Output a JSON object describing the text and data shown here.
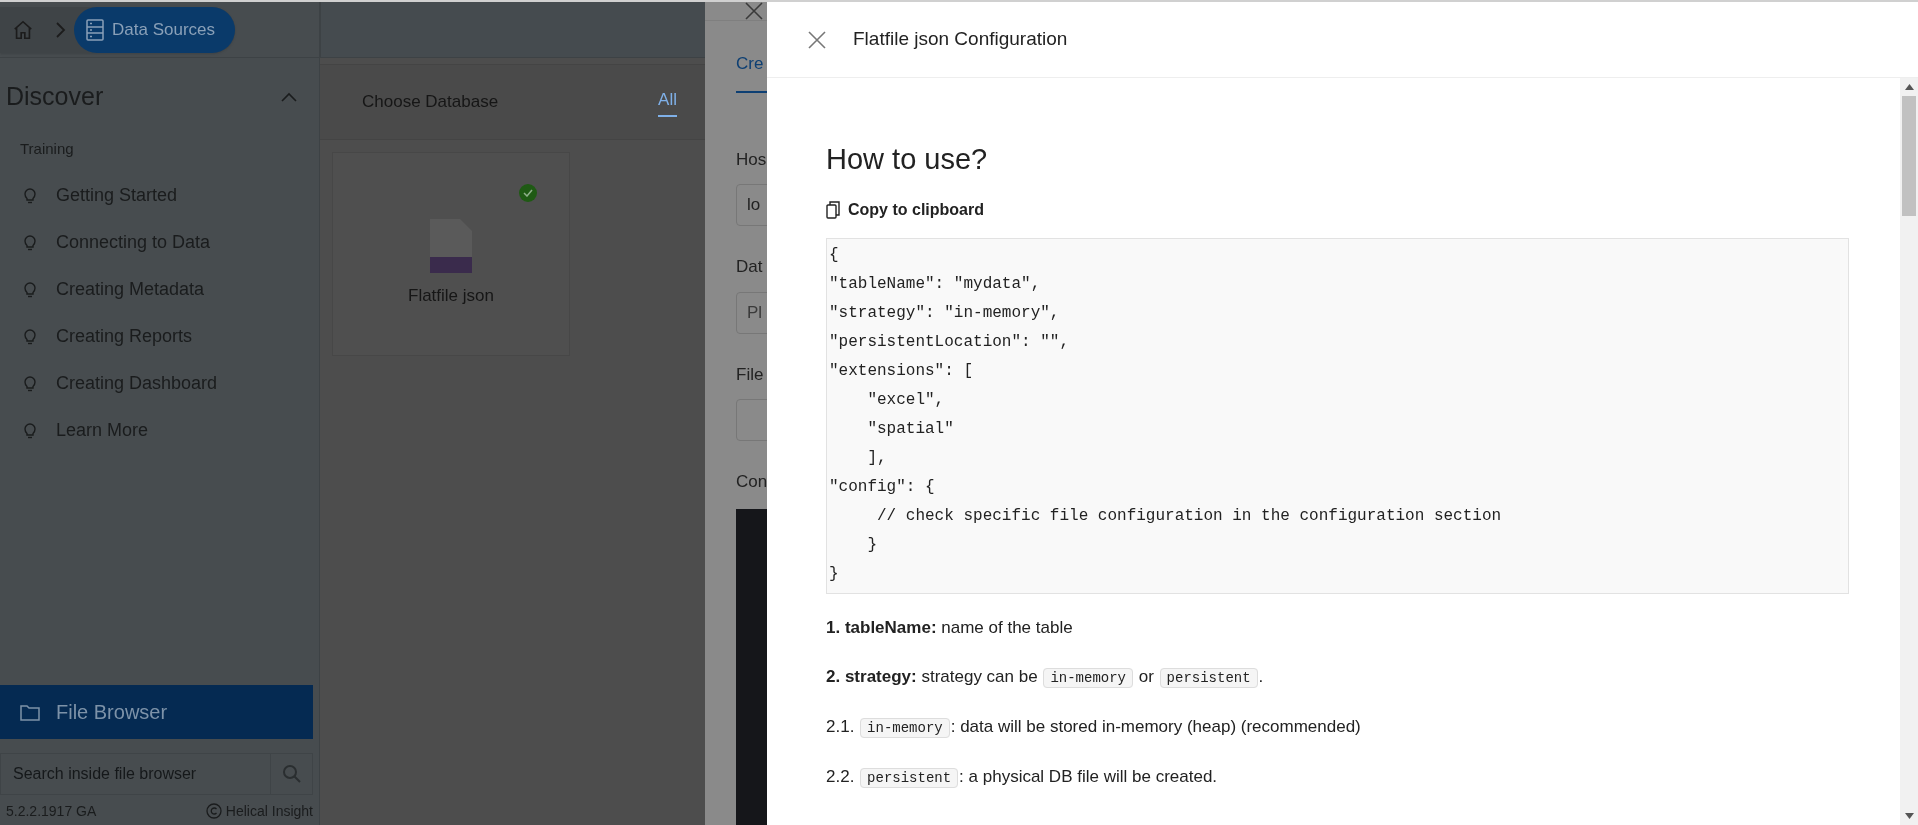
{
  "breadcrumb": {
    "current": "Data Sources"
  },
  "sidebar": {
    "title": "Discover",
    "expanded": true,
    "section": "Training",
    "items": [
      "Getting Started",
      "Connecting to Data",
      "Creating Metadata",
      "Creating Reports",
      "Creating Dashboard",
      "Learn More"
    ],
    "file_browser": "File Browser",
    "search": {
      "placeholder": "Search inside file browser"
    },
    "version": "5.2.2.1917 GA",
    "brand": "Helical Insight"
  },
  "chooser": {
    "title": "Choose Database",
    "tabs": [
      {
        "label": "All",
        "selected": true
      }
    ],
    "cards": [
      {
        "label": "Flatfile json",
        "selected": true
      }
    ]
  },
  "back_drawer": {
    "tabs": [
      {
        "label": "Cre",
        "selected": true
      }
    ],
    "items": [
      {
        "kind": "label",
        "text": "Hos"
      },
      {
        "kind": "field",
        "value": "lo"
      },
      {
        "kind": "label",
        "text": "Dat"
      },
      {
        "kind": "field",
        "placeholder": "Pl"
      },
      {
        "kind": "label",
        "text": "File"
      },
      {
        "kind": "field"
      },
      {
        "kind": "label",
        "text": "Con"
      },
      {
        "kind": "editor"
      }
    ]
  },
  "config_panel": {
    "title": "Flatfile json Configuration",
    "heading": "How to use?",
    "copy_button": "Copy to clipboard",
    "code": [
      "{",
      "\"tableName\": \"mydata\",",
      "\"strategy\": \"in-memory\",",
      "\"persistentLocation\": \"\",",
      "\"extensions\": [",
      "    \"excel\",",
      "    \"spatial\"",
      "    ],",
      "\"config\": {",
      "     // check specific file configuration in the configuration section",
      "    }",
      "}"
    ],
    "notes": [
      [
        {
          "kind": "text",
          "text": "**1. tableName:** name of the table"
        }
      ],
      [
        {
          "kind": "text",
          "text": "**2. strategy:** strategy can be "
        },
        {
          "kind": "code",
          "text": "in-memory"
        },
        {
          "kind": "text",
          "text": " or "
        },
        {
          "kind": "code",
          "text": "persistent"
        },
        {
          "kind": "text",
          "text": "."
        }
      ],
      [
        {
          "kind": "text",
          "text": "2.1. "
        },
        {
          "kind": "code",
          "text": "in-memory"
        },
        {
          "kind": "text",
          "text": ": data will be stored in-memory (heap) (recommended)"
        }
      ],
      [
        {
          "kind": "text",
          "text": "2.2. "
        },
        {
          "kind": "code",
          "text": "persistent"
        },
        {
          "kind": "text",
          "text": ": a physical DB file will be created."
        }
      ]
    ]
  }
}
